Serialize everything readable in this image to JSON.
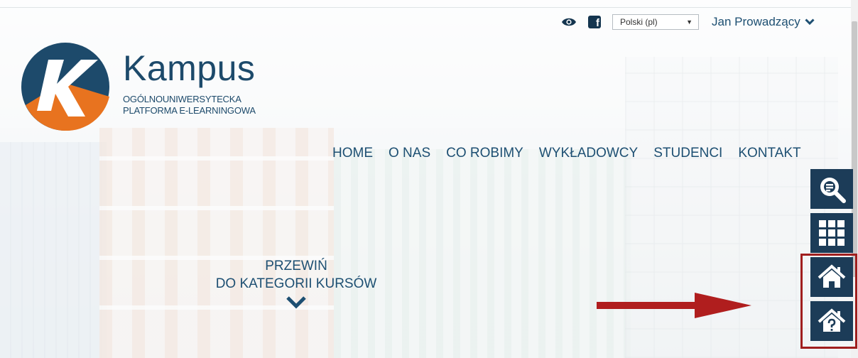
{
  "header": {
    "language_selected": "Polski (pl)",
    "user_name": "Jan Prowadzący",
    "icons": [
      "eye-icon",
      "facebook-icon",
      "chevron-down-icon"
    ]
  },
  "logo": {
    "wordmark": "Kampus",
    "subtitle_line1": "OGÓLNOUNIWERSYTECKA",
    "subtitle_line2": "PLATFORMA E-LEARNINGOWA",
    "colors": {
      "blue": "#1d4a6b",
      "orange": "#e8731f"
    }
  },
  "nav": {
    "items": [
      {
        "label": "HOME"
      },
      {
        "label": "O NAS"
      },
      {
        "label": "CO ROBIMY"
      },
      {
        "label": "WYKŁADOWCY"
      },
      {
        "label": "STUDENCI"
      },
      {
        "label": "KONTAKT"
      }
    ]
  },
  "scroll_prompt": {
    "line1": "PRZEWIŃ",
    "line2": "DO KATEGORII KURSÓW"
  },
  "side_buttons": [
    {
      "icon": "search-icon"
    },
    {
      "icon": "grid-icon"
    },
    {
      "icon": "home-icon"
    },
    {
      "icon": "home-question-icon"
    }
  ],
  "colors": {
    "accent": "#1d4f72",
    "button_bg": "#1c3c58",
    "highlight": "#a01e1e"
  }
}
